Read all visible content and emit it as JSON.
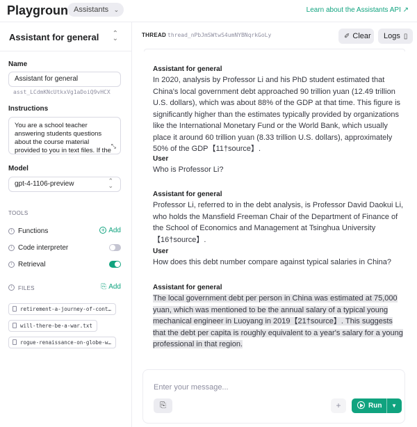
{
  "header": {
    "brand": "Playground",
    "mode": "Assistants",
    "learn_link": "Learn about the Assistants API ↗"
  },
  "sidebar": {
    "assistant_selector": "Assistant for general",
    "name_label": "Name",
    "name_value": "Assistant for general",
    "assistant_id": "asst_LCdmKNcUtkxVg1aDoiQ9vHCX",
    "instructions_label": "Instructions",
    "instructions_value": "You are a school teacher answering students questions about the course material provided to you in text files. If the  response is not in the text files, reply with 'I don't know'",
    "model_label": "Model",
    "model_value": "gpt-4-1106-preview",
    "tools_label": "TOOLS",
    "tools": [
      {
        "name": "Functions",
        "action": "Add"
      },
      {
        "name": "Code interpreter",
        "enabled": false
      },
      {
        "name": "Retrieval",
        "enabled": true
      }
    ],
    "files_label": "FILES",
    "files_action": "Add",
    "files": [
      "retirement-a-journey-of-cont…",
      "will-there-be-a-war.txt",
      "rogue-renaissance-on-globe-w…"
    ]
  },
  "thread": {
    "label": "THREAD",
    "id": "thread_nPbJmSWtwS4umNYBNqrkGoLy",
    "clear_label": "Clear",
    "logs_label": "Logs"
  },
  "messages": [
    {
      "role": "Assistant for general",
      "text": "In 2020, analysis by Professor Li and his PhD student estimated that China's local government debt approached 90 trillion yuan (12.49 trillion U.S. dollars), which was about 88% of the GDP at that time. This figure is significantly higher than the estimates typically provided by organizations like the International Monetary Fund or the World Bank, which usually place it around 60 trillion yuan (8.33 trillion U.S. dollars), approximately 50% of the GDP【11†source】."
    },
    {
      "role": "User",
      "text": "Who is Professor Li?"
    },
    {
      "role": "Assistant for general",
      "text": "Professor Li, referred to in the debt analysis, is Professor David Daokui Li, who holds the Mansfield Freeman Chair of the Department of Finance of the School of Economics and Management at Tsinghua University【16†source】."
    },
    {
      "role": "User",
      "text": "How does this debt number compare against typical salaries in China?"
    },
    {
      "role": "Assistant for general",
      "text": "The local government debt per person in China was estimated at 75,000 yuan, which was mentioned to be the annual salary of a typical young mechanical engineer in Luoyang in 2019【21†source】. This suggests that the debt per capita is roughly equivalent to a year's salary for a young professional in that region."
    }
  ],
  "composer": {
    "placeholder": "Enter your message...",
    "run_label": "Run"
  },
  "colors": {
    "accent": "#10a37f",
    "border": "#ececf1",
    "text": "#202123",
    "highlight": "#e5e5e8"
  }
}
